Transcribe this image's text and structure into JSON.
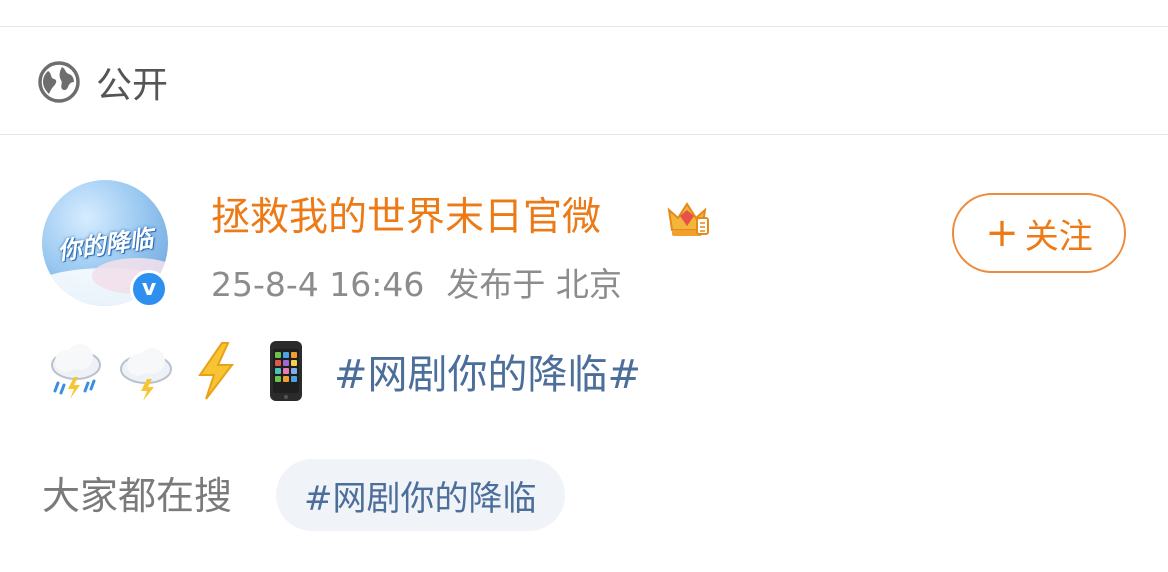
{
  "visibility": {
    "label": "公开",
    "icon": "globe-icon"
  },
  "post": {
    "author": {
      "name": "拯救我的世界末日官微",
      "avatar_text": "你的降临",
      "verified_mark": "v",
      "badge_icon": "crown-icon"
    },
    "time": "25-8-4 16:46",
    "location": "发布于 北京",
    "follow_label": "关注",
    "content": {
      "emojis": [
        "rain-thunder-cloud-icon",
        "lightning-cloud-icon",
        "lightning-bolt-icon",
        "mobile-phone-icon"
      ],
      "hashtag": "#网剧你的降临#"
    }
  },
  "searches": {
    "label": "大家都在搜",
    "chips": [
      {
        "text": "#网剧你的降临"
      }
    ]
  },
  "colors": {
    "author_name": "#ec7a16",
    "follow_border": "#ee8a3a",
    "hashtag": "#4c6e9a",
    "meta_text": "#8c8c8c",
    "verified": "#2d8ff0",
    "chip_bg": "#f0f3f8"
  }
}
